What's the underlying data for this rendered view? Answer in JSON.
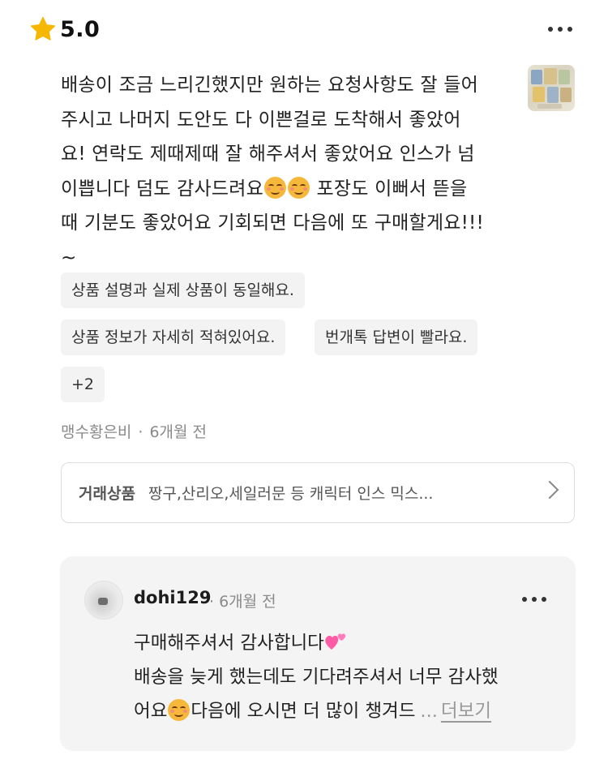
{
  "review": {
    "rating": "5.0",
    "text_lines": [
      "배송이 조금 느리긴했지만 원하는 요청사항도 잘 들어",
      "주시고 나머지 도안도 다 이쁜걸로 도착해서 좋았어",
      "요! 연락도 제때제때 잘 해주셔서 좋았어요 인스가 넘",
      "이쁩니다 덤도 감사드려요",
      "포장도 이뻐서 뜯을",
      "때 기분도 좋았어요 기회되면 다음에 또 구매할게요!!!",
      "~"
    ],
    "tags": [
      "상품 설명과 실제 상품이 동일해요.",
      "상품 정보가 자세히 적혀있어요.",
      "번개톡 답변이 빨라요.",
      "+2"
    ],
    "author": "맹수황은비",
    "time": "6개월 전",
    "product_label": "거래상품",
    "product_name": "짱구,산리오,세일러문 등 캐릭터 인스 믹스..."
  },
  "reply": {
    "user": "dohi129",
    "time": "6개월 전",
    "line1": "구매해주셔서 감사합니다",
    "line2": "배송을 늦게 했는데도 기다려주셔서 너무 감사했",
    "line3_a": "어요",
    "line3_b": "다음에 오시면 더 많이 챙겨드",
    "ellipsis": "...",
    "see_more": "더보기"
  },
  "icons": {
    "rating": "star-icon",
    "more": "more-icon",
    "emoji": "smiling-face-icon",
    "heart": "two-hearts-icon",
    "chevron": "chevron-right-icon"
  },
  "colors": {
    "star": "#F5B700",
    "tag_bg": "#F3F3F3",
    "reply_bg": "#F4F4F4",
    "muted_text": "#8A8A8A"
  }
}
